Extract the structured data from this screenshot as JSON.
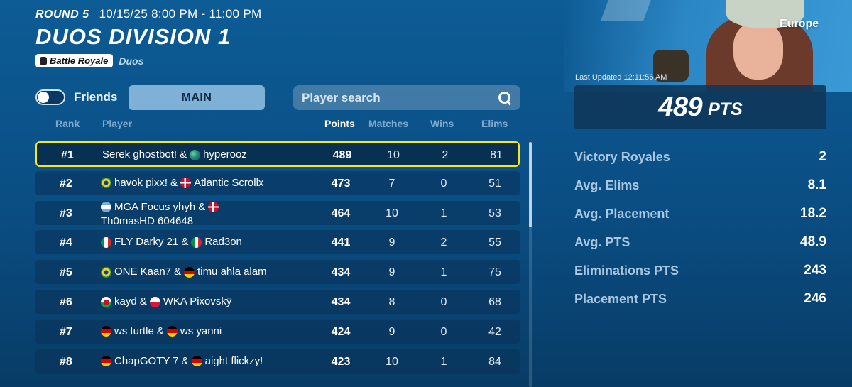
{
  "event": {
    "round": "ROUND 5",
    "time": "10/15/25 8:00 PM - 11:00 PM",
    "title": "DUOS DIVISION 1",
    "mode_pill": "Battle Royale",
    "mode_sub": "Duos"
  },
  "controls": {
    "friends_label": "Friends",
    "friends_toggle_on": false,
    "main_tab": "MAIN",
    "search_placeholder": "Player search"
  },
  "table": {
    "headers": {
      "rank": "Rank",
      "player": "Player",
      "points": "Points",
      "matches": "Matches",
      "wins": "Wins",
      "elims": "Elims"
    },
    "rows": [
      {
        "rank": "#1",
        "p1": "Serek ghostbot!",
        "flag1": "",
        "flag2": "globe",
        "p2": "hyperooz",
        "points": "489",
        "matches": "10",
        "wins": "2",
        "elims": "81"
      },
      {
        "rank": "#2",
        "p1": "havok pixx!",
        "flag1": "br",
        "flag2": "dk",
        "p2": "Atlantic Scrollx",
        "points": "473",
        "matches": "7",
        "wins": "0",
        "elims": "51"
      },
      {
        "rank": "#3",
        "p1": "MGA Focus yhyh",
        "flag1": "ar",
        "flag2": "dk",
        "p2": "Th0masHD 604648",
        "points": "464",
        "matches": "10",
        "wins": "1",
        "elims": "53"
      },
      {
        "rank": "#4",
        "p1": "FLY Darky 21",
        "flag1": "it",
        "flag2": "it",
        "p2": "Rad3on",
        "points": "441",
        "matches": "9",
        "wins": "2",
        "elims": "55"
      },
      {
        "rank": "#5",
        "p1": "ONE Kaan7",
        "flag1": "br",
        "flag2": "de",
        "p2": "timu ahla alam",
        "points": "434",
        "matches": "9",
        "wins": "1",
        "elims": "75"
      },
      {
        "rank": "#6",
        "p1": "kayd",
        "flag1": "wales",
        "flag2": "pl",
        "p2": "WKA Pixovskÿ",
        "points": "434",
        "matches": "8",
        "wins": "0",
        "elims": "68"
      },
      {
        "rank": "#7",
        "p1": "ws turtle",
        "flag1": "de",
        "flag2": "de",
        "p2": "ws yanni",
        "points": "424",
        "matches": "9",
        "wins": "0",
        "elims": "42"
      },
      {
        "rank": "#8",
        "p1": "ChapGOTY 7",
        "flag1": "de",
        "flag2": "de",
        "p2": "aight flickzy!",
        "points": "423",
        "matches": "10",
        "wins": "1",
        "elims": "84"
      }
    ]
  },
  "summary": {
    "region": "Europe",
    "last_updated": "Last Updated 12:11:56 AM",
    "points_value": "489",
    "points_unit": "PTS",
    "stats": [
      {
        "label": "Victory Royales",
        "value": "2"
      },
      {
        "label": "Avg. Elims",
        "value": "8.1"
      },
      {
        "label": "Avg. Placement",
        "value": "18.2"
      },
      {
        "label": "Avg. PTS",
        "value": "48.9"
      },
      {
        "label": "Eliminations PTS",
        "value": "243"
      },
      {
        "label": "Placement PTS",
        "value": "246"
      }
    ]
  },
  "colors": {
    "highlight_border": "#f5e625",
    "background": "#0d5c96",
    "main_tab_bg": "#7fb0d6"
  }
}
